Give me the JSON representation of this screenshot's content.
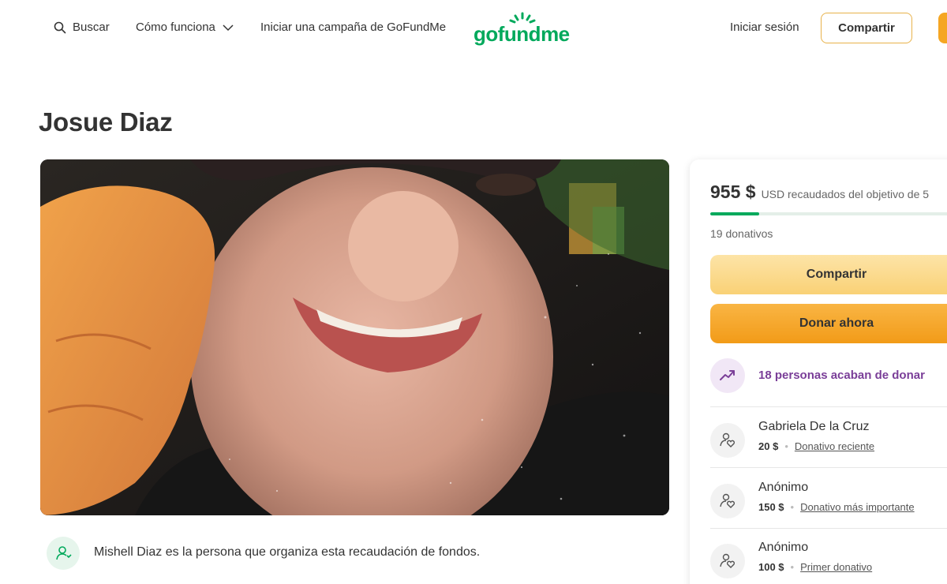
{
  "header": {
    "search_label": "Buscar",
    "how_it_works_label": "Cómo funciona",
    "start_campaign_label": "Iniciar una campaña de GoFundMe",
    "logo_text": "gofundme",
    "login_label": "Iniciar sesión",
    "share_label": "Compartir"
  },
  "campaign": {
    "title": "Josue Diaz",
    "organizer_text": "Mishell Diaz es la persona que organiza esta recaudación de fondos."
  },
  "donation_card": {
    "raised_amount": "955 $",
    "raised_goal_text": "USD recaudados del objetivo de 5",
    "progress_fraction": 0.2,
    "donation_count": "19 donativos",
    "share_button": "Compartir",
    "donate_button": "Donar ahora",
    "recent_activity": "18 personas acaban de donar",
    "donors": [
      {
        "name": "Gabriela De la Cruz",
        "amount": "20 $",
        "tag": "Donativo reciente"
      },
      {
        "name": "Anónimo",
        "amount": "150 $",
        "tag": "Donativo más importante"
      },
      {
        "name": "Anónimo",
        "amount": "100 $",
        "tag": "Primer donativo"
      }
    ]
  },
  "colors": {
    "brand_green": "#02a95c",
    "donate_orange": "#f29b18",
    "share_yellow": "#f9d176",
    "accent_purple": "#7a3e98"
  },
  "icons": {
    "search": "search-icon",
    "chevron": "chevron-down-icon",
    "trend": "trending-up-icon",
    "donor": "donor-heart-icon",
    "organizer": "organizer-icon"
  }
}
